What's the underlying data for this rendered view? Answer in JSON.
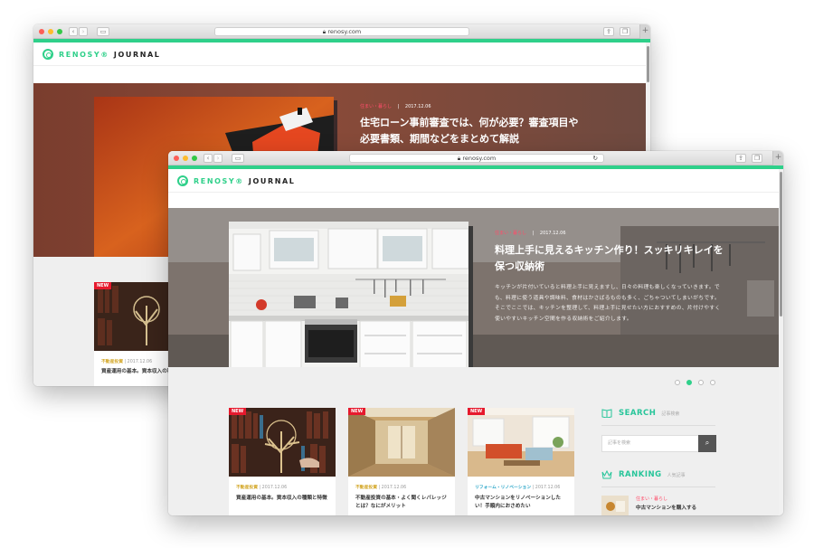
{
  "back_window": {
    "url": "renosy.com",
    "logo_brand": "RENOSY®",
    "logo_section": "JOURNAL",
    "hero": {
      "category": "住まい・暮らし",
      "date": "2017.12.06",
      "title": "住宅ローン事前審査では、何が必要？審査項目や必要書類、期間などをまとめて解説"
    },
    "card": {
      "badge": "NEW",
      "category": "不動産投資",
      "date": "2017.12.06",
      "title": "資産運用の基本。資本収入の種類と特徴"
    }
  },
  "front_window": {
    "url": "renosy.com",
    "logo_brand": "RENOSY®",
    "logo_section": "JOURNAL",
    "hero": {
      "category": "住まい・暮らし",
      "date": "2017.12.06",
      "title": "料理上手に見えるキッチン作り！スッキリキレイを保つ収納術",
      "excerpt": "キッチンが片付いていると料理上手に見えますし、日々の料理も楽しくなっていきます。でも、料理に使う道具や調味料、食材はかさばるものも多く、ごちゃついてしまいがちです。そこでここでは、キッチンを整理して、料理上手に見せたい方におすすめの、片付けやすく使いやすいキッチン空間を作る収納術をご紹介します。"
    },
    "pager": {
      "count": 4,
      "active_index": 1
    },
    "cards": [
      {
        "badge": "NEW",
        "category": "不動産投資",
        "date": "2017.12.06",
        "title": "資産運用の基本。資本収入の種類と特徴",
        "category_color": "#d4a82a"
      },
      {
        "badge": "NEW",
        "category": "不動産投資",
        "date": "2017.12.06",
        "title": "不動産投資の基本・よく聞くレバレッジとは？なにがメリット",
        "category_color": "#d4a82a"
      },
      {
        "badge": "NEW",
        "category": "リフォーム・リノベーション",
        "date": "2017.12.06",
        "title": "中古マンションをリノベーションしたい！手順内におさめたい",
        "category_color": "#2aa6c8"
      }
    ],
    "sidebar": {
      "search_title": "SEARCH",
      "search_sub": "記事検索",
      "search_placeholder": "記事を検索",
      "ranking_title": "RANKING",
      "ranking_sub": "人気記事",
      "ranking_item": {
        "category": "住まい・暮らし",
        "title": "中古マンションを購入する"
      }
    }
  },
  "colors": {
    "accent": "#2fd08a",
    "new_badge": "#e6192d",
    "hero_category": "#ff4d6a",
    "sidebar_heading": "#27c59a"
  }
}
